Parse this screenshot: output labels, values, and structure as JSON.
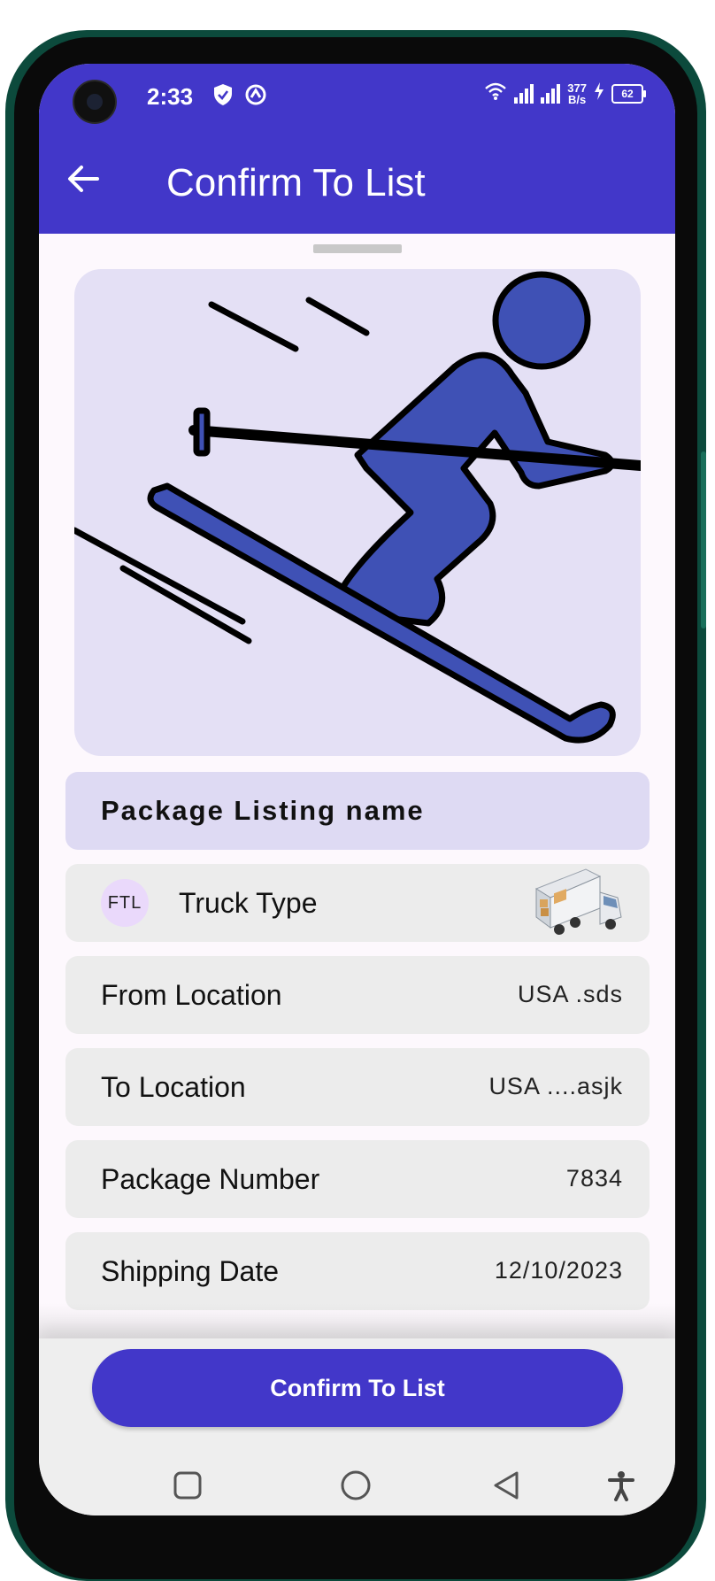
{
  "status_bar": {
    "time": "2:33",
    "net_speed_value": "377",
    "net_speed_unit": "B/s",
    "battery": "62",
    "icons": [
      "shield-check-icon",
      "sync-icon",
      "wifi-icon",
      "signal-icon",
      "signal-icon",
      "charging-icon",
      "battery-icon"
    ]
  },
  "app_bar": {
    "title": "Confirm To List",
    "back_icon": "arrow-left-icon"
  },
  "colors": {
    "primary": "#4237c9",
    "header_card": "#dedaf3",
    "row_card": "#ececec",
    "illustration_bg": "#e4e0f5",
    "skier": "#3f51b5"
  },
  "illustration": {
    "icon": "skier-icon"
  },
  "package": {
    "listing_name": "Package Listing name",
    "truck": {
      "badge": "FTL",
      "label": "Truck Type",
      "icon": "truck-icon"
    },
    "rows": [
      {
        "label": "From Location",
        "value": "USA .sds"
      },
      {
        "label": "To Location",
        "value": "USA ....asjk"
      },
      {
        "label": "Package Number",
        "value": "7834"
      },
      {
        "label": "Shipping Date",
        "value": "12/10/2023"
      }
    ]
  },
  "actions": {
    "confirm_label": "Confirm To List"
  },
  "nav_bar": {
    "icons": [
      "recents-square-icon",
      "home-circle-icon",
      "back-triangle-icon",
      "accessibility-icon"
    ]
  }
}
